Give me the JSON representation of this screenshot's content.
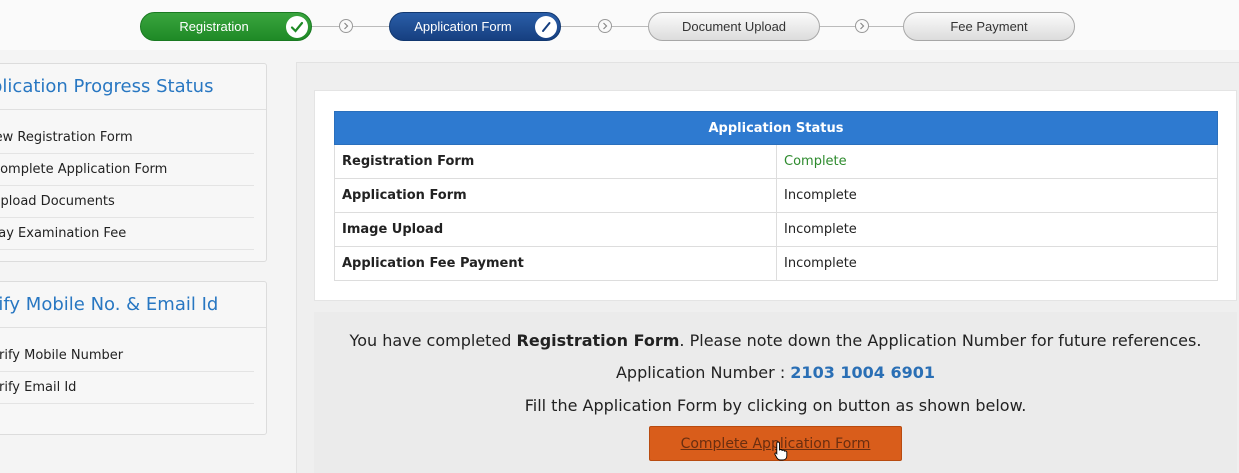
{
  "stepper": {
    "steps": [
      {
        "label": "Registration",
        "state": "done"
      },
      {
        "label": "Application Form",
        "state": "active"
      },
      {
        "label": "Document Upload",
        "state": "pending"
      },
      {
        "label": "Fee Payment",
        "state": "pending"
      }
    ]
  },
  "progress_panel": {
    "title": "plication Progress Status",
    "items": [
      {
        "label": "iew Registration Form"
      },
      {
        "label": "Complete Application Form"
      },
      {
        "label": "Upload Documents"
      },
      {
        "label": "Pay Examination Fee"
      }
    ]
  },
  "verify_panel": {
    "title": "rify Mobile No. & Email Id",
    "items": [
      {
        "label": "erify Mobile Number"
      },
      {
        "label": "erify Email Id"
      }
    ]
  },
  "status_table": {
    "header": "Application Status",
    "rows": [
      {
        "field": "Registration Form",
        "status": "Complete"
      },
      {
        "field": "Application Form",
        "status": "Incomplete"
      },
      {
        "field": "Image Upload",
        "status": "Incomplete"
      },
      {
        "field": "Application Fee Payment",
        "status": "Incomplete"
      }
    ]
  },
  "message": {
    "line1_prefix": "You have completed ",
    "line1_bold": "Registration Form",
    "line1_suffix": ". Please note down the Application Number for future references.",
    "appno_label": "Application Number : ",
    "appno_value": "2103 1004 6901",
    "line3": "Fill the Application Form by clicking on button as shown below."
  },
  "cta": {
    "label": "Complete Application Form"
  },
  "colors": {
    "done": "#1f8a26",
    "active": "#163f80",
    "header_blue": "#2e7ad0",
    "complete_green": "#2e8b2e",
    "cta_orange": "#d95d1b",
    "link_blue": "#2877c2"
  }
}
